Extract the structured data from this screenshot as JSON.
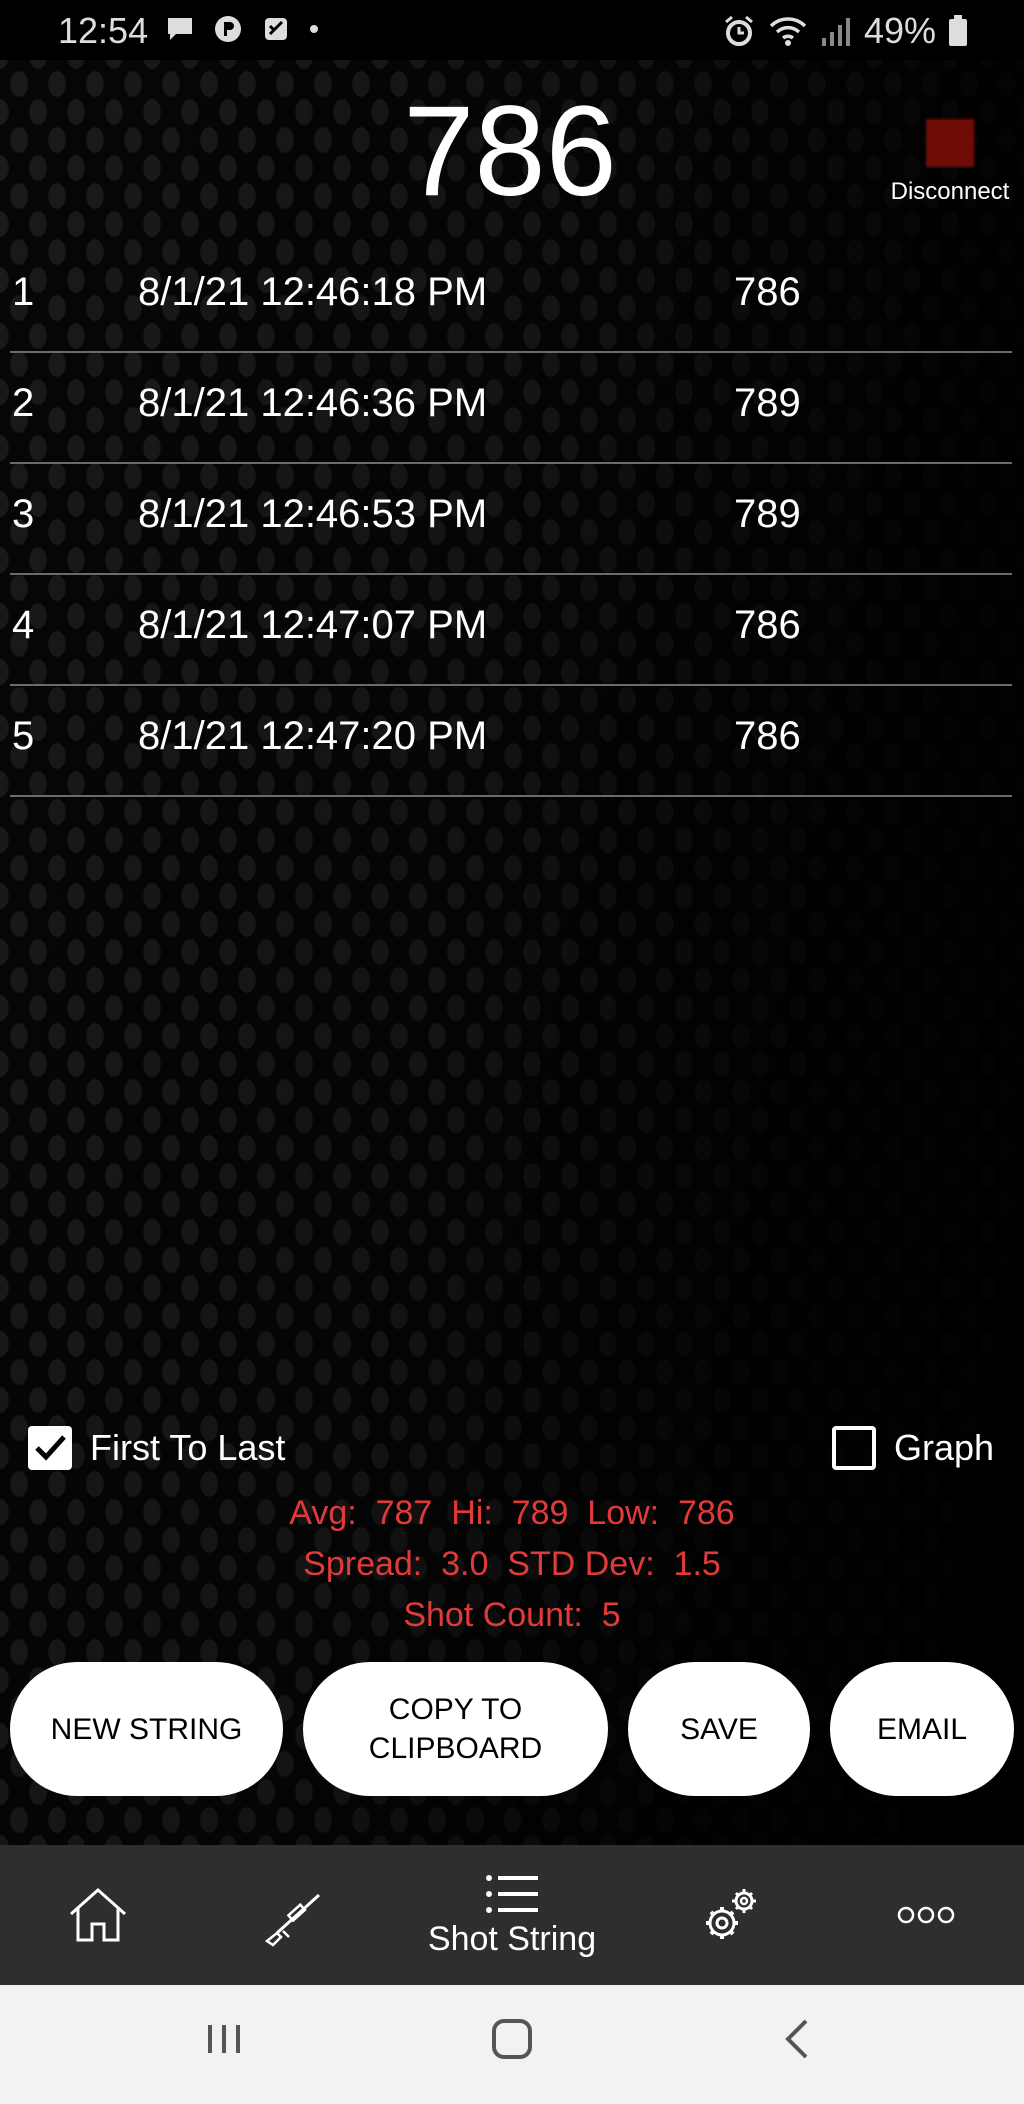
{
  "status_bar": {
    "time": "12:54",
    "battery": "49%"
  },
  "header": {
    "current_value": "786",
    "disconnect_label": "Disconnect",
    "disconnect_color": "#6e0d06"
  },
  "shots": [
    {
      "num": "1",
      "time": "8/1/21 12:46:18 PM",
      "value": "786"
    },
    {
      "num": "2",
      "time": "8/1/21 12:46:36 PM",
      "value": "789"
    },
    {
      "num": "3",
      "time": "8/1/21 12:46:53 PM",
      "value": "789"
    },
    {
      "num": "4",
      "time": "8/1/21 12:47:07 PM",
      "value": "786"
    },
    {
      "num": "5",
      "time": "8/1/21 12:47:20 PM",
      "value": "786"
    }
  ],
  "options": {
    "first_to_last": {
      "label": "First To Last",
      "checked": true
    },
    "graph": {
      "label": "Graph",
      "checked": false
    }
  },
  "stats": {
    "line1": "Avg:  787  Hi:  789  Low:  786",
    "line2": "Spread:  3.0  STD Dev:  1.5",
    "line3": "Shot Count:  5",
    "color": "#e03a3a"
  },
  "buttons": {
    "new_string": "NEW STRING",
    "copy_line1": "COPY TO",
    "copy_line2": "CLIPBOARD",
    "save": "SAVE",
    "email": "EMAIL"
  },
  "bottom_nav": {
    "active_label": "Shot String",
    "items": [
      "home-icon",
      "rifle-icon",
      "list-icon",
      "gears-icon",
      "more-icon"
    ]
  },
  "system_nav": [
    "recents-icon",
    "home-button-icon",
    "back-icon"
  ]
}
